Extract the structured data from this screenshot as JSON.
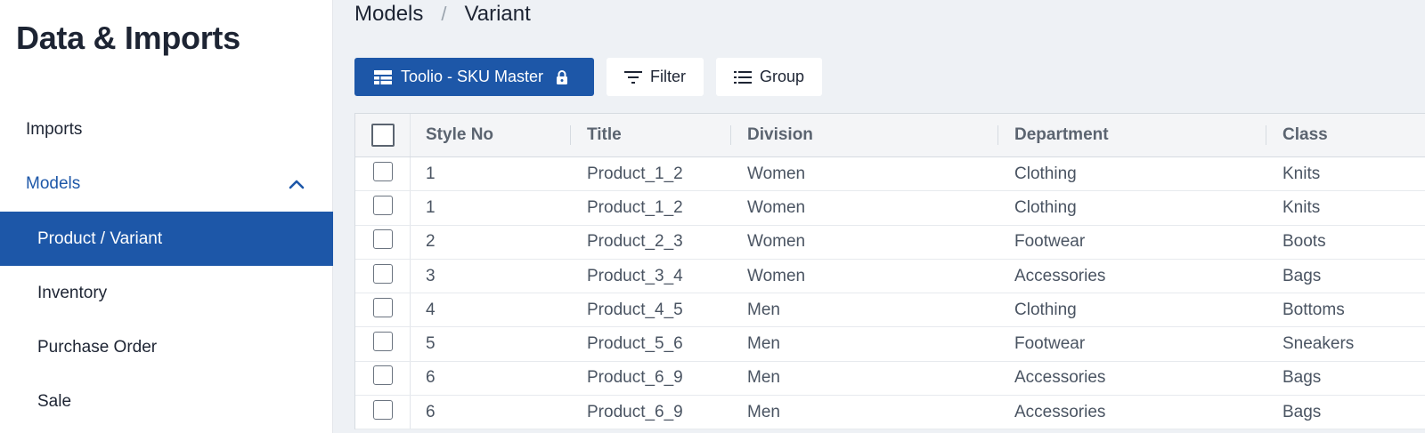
{
  "app": {
    "title": "Data & Imports"
  },
  "sidebar": {
    "items": [
      {
        "label": "Imports"
      },
      {
        "label": "Models"
      },
      {
        "label": "Product / Variant"
      },
      {
        "label": "Inventory"
      },
      {
        "label": "Purchase Order"
      },
      {
        "label": "Sale"
      }
    ]
  },
  "breadcrumb": {
    "parent": "Models",
    "separator": "/",
    "current": "Variant"
  },
  "toolbar": {
    "view_label": "Toolio - SKU Master",
    "filter_label": "Filter",
    "group_label": "Group"
  },
  "table": {
    "columns": [
      "Style No",
      "Title",
      "Division",
      "Department",
      "Class"
    ],
    "rows": [
      [
        "1",
        "Product_1_2",
        "Women",
        "Clothing",
        "Knits"
      ],
      [
        "1",
        "Product_1_2",
        "Women",
        "Clothing",
        "Knits"
      ],
      [
        "2",
        "Product_2_3",
        "Women",
        "Footwear",
        "Boots"
      ],
      [
        "3",
        "Product_3_4",
        "Women",
        "Accessories",
        "Bags"
      ],
      [
        "4",
        "Product_4_5",
        "Men",
        "Clothing",
        "Bottoms"
      ],
      [
        "5",
        "Product_5_6",
        "Men",
        "Footwear",
        "Sneakers"
      ],
      [
        "6",
        "Product_6_9",
        "Men",
        "Accessories",
        "Bags"
      ],
      [
        "6",
        "Product_6_9",
        "Men",
        "Accessories",
        "Bags"
      ]
    ]
  },
  "colors": {
    "accent": "#1d57a8",
    "background": "#eef1f5",
    "sidebar": "#ffffff"
  }
}
